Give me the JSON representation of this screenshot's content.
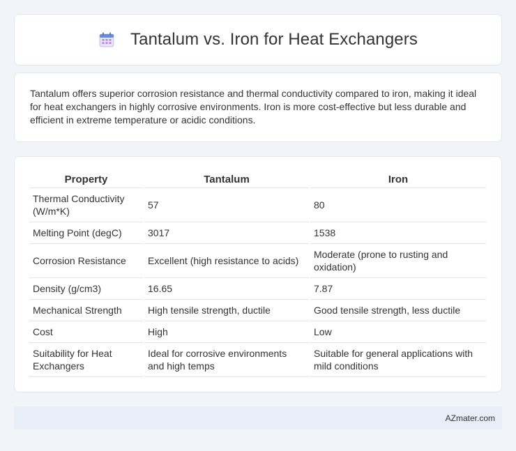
{
  "header": {
    "icon": "calendar-icon",
    "title": "Tantalum vs. Iron for Heat Exchangers"
  },
  "intro": {
    "text": "Tantalum offers superior corrosion resistance and thermal conductivity compared to iron, making it ideal for heat exchangers in highly corrosive environments. Iron is more cost-effective but less durable and efficient in extreme temperature or acidic conditions."
  },
  "table": {
    "headers": [
      "Property",
      "Tantalum",
      "Iron"
    ],
    "rows": [
      [
        "Thermal Conductivity (W/m*K)",
        "57",
        "80"
      ],
      [
        "Melting Point (degC)",
        "3017",
        "1538"
      ],
      [
        "Corrosion Resistance",
        "Excellent (high resistance to acids)",
        "Moderate (prone to rusting and oxidation)"
      ],
      [
        "Density (g/cm3)",
        "16.65",
        "7.87"
      ],
      [
        "Mechanical Strength",
        "High tensile strength, ductile",
        "Good tensile strength, less ductile"
      ],
      [
        "Cost",
        "High",
        "Low"
      ],
      [
        "Suitability for Heat Exchangers",
        "Ideal for corrosive environments and high temps",
        "Suitable for general applications with mild conditions"
      ]
    ]
  },
  "footer": {
    "text": "AZmater.com"
  },
  "colors": {
    "background": "#f1f4f9",
    "card": "#ffffff",
    "footer": "#e8eef8",
    "text": "#333333"
  }
}
